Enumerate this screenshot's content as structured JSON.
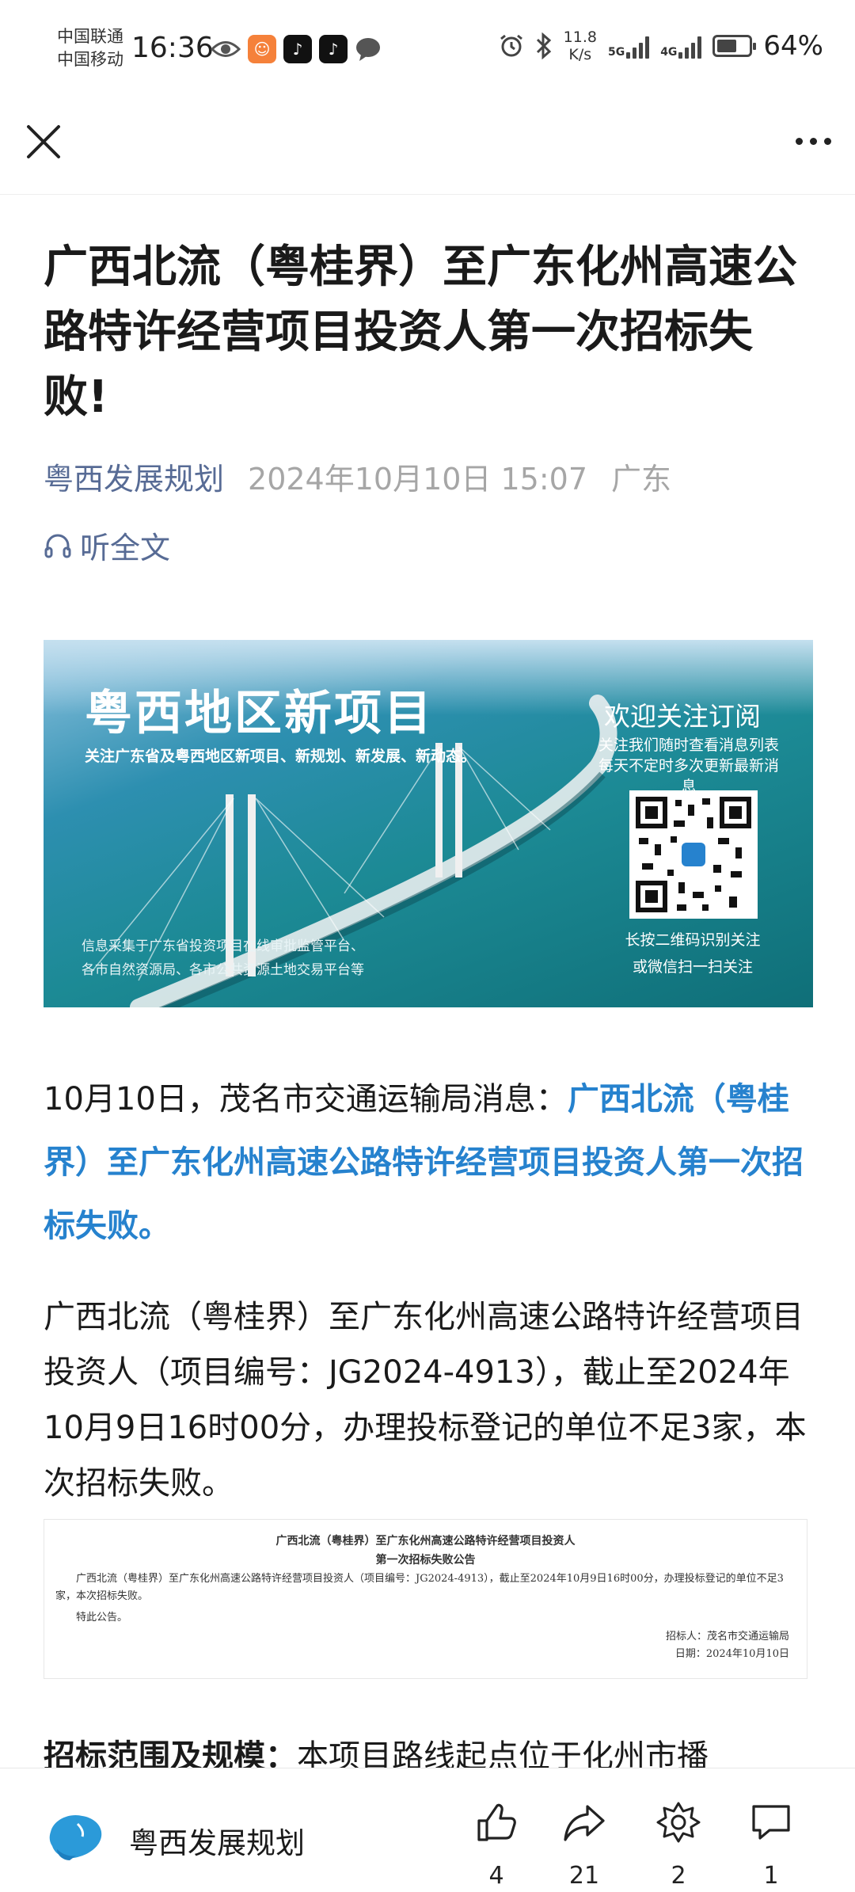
{
  "status_bar": {
    "carrier_1": "中国联通",
    "carrier_2": "中国移动",
    "time": "16:36",
    "net_speed": "11.8",
    "net_speed_unit": "K/s",
    "net_type_1": "5G",
    "net_type_2": "4G",
    "battery_percent": "64%",
    "battery_level": 0.64,
    "left_icons": [
      "eye-icon",
      "taobao-icon",
      "tiktok-icon",
      "tiktok-icon",
      "chat-bubble-icon"
    ],
    "right_icons": [
      "alarm-icon",
      "bluetooth-icon"
    ]
  },
  "nav": {
    "close_icon": "close-icon",
    "more_icon": "more-icon"
  },
  "article": {
    "title": "广西北流（粤桂界）至广东化州高速公路特许经营项目投资人第一次招标失败!",
    "author": "粤西发展规划",
    "date": "2024年10月10日 15:07",
    "location": "广东",
    "listen_label": "听全文",
    "banner": {
      "title": "粤西地区新项目",
      "subtitle": "关注广东省及粤西地区新项目、新规划、新发展、新动态。",
      "footer_line_1": "信息采集于广东省投资项目在线审批监管平台、",
      "footer_line_2": "各市自然资源局、各市公共资源土地交易平台等",
      "welcome": "欢迎关注订阅",
      "note_1": "关注我们随时查看消息列表",
      "note_2": "每天不定时多次更新最新消息",
      "scan_1": "长按二维码识别关注",
      "scan_2": "或微信扫一扫关注"
    },
    "p1_prefix": "10月10日，茂名市交通运输局消息：",
    "p1_highlight": "广西北流（粤桂界）至广东化州高速公路特许经营项目投资人第一次招标失败。",
    "p2": "广西北流（粤桂界）至广东化州高速公路特许经营项目投资人（项目编号：JG2024-4913），截止至2024年10月9日16时00分，办理投标登记的单位不足3家，本次招标失败。",
    "notice": {
      "title_1": "广西北流（粤桂界）至广东化州高速公路特许经营项目投资人",
      "title_2": "第一次招标失败公告",
      "body": "广西北流（粤桂界）至广东化州高速公路特许经营项目投资人（项目编号：JG2024-4913），截止至2024年10月9日16时00分，办理投标登记的单位不足3家，本次招标失败。",
      "special": "特此公告。",
      "signer": "招标人：茂名市交通运输局",
      "date": "日期：2024年10月10日"
    },
    "p3_bold": "招标范围及规模：",
    "p3_text": "本项目路线起点位于化州市播"
  },
  "bottom_bar": {
    "account_name": "粤西发展规划",
    "like_count": "4",
    "share_count": "21",
    "recommend_count": "2",
    "comment_count": "1"
  }
}
